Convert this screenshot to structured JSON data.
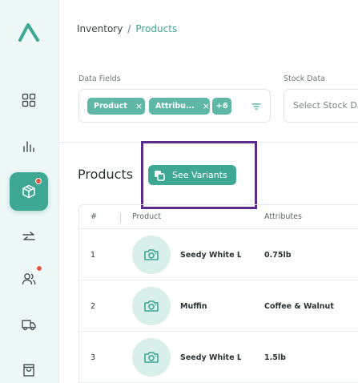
{
  "breadcrumb": {
    "root": "Inventory",
    "separator": "/",
    "current": "Products"
  },
  "filters": {
    "data_fields": {
      "label": "Data Fields",
      "chips": [
        {
          "label": "Product",
          "remove": "×"
        },
        {
          "label": "Attribu...",
          "remove": "×"
        }
      ],
      "more": "+6"
    },
    "stock_data": {
      "label": "Stock Data",
      "placeholder": "Select Stock Da"
    }
  },
  "products": {
    "title": "Products",
    "see_variants": "See Variants"
  },
  "table": {
    "headers": {
      "index": "#",
      "product": "Product",
      "attributes": "Attributes"
    },
    "rows": [
      {
        "index": "1",
        "name": "Seedy White Loa",
        "attributes": "0.75lb"
      },
      {
        "index": "2",
        "name": "Muffin",
        "attributes": "Coffee & Walnut"
      },
      {
        "index": "3",
        "name": "Seedy White Loa",
        "attributes": "1.5lb"
      }
    ]
  },
  "colors": {
    "accent": "#3ea894",
    "chip": "#5fb8a6",
    "sidebar": "#eef8f6",
    "highlight": "#5b2d8a",
    "badge": "#e2553f"
  },
  "icons": {
    "sidebar": [
      "logo-icon",
      "dashboard-icon",
      "analytics-icon",
      "products-box-icon",
      "transfer-icon",
      "users-icon",
      "truck-icon",
      "shopping-bag-icon"
    ],
    "thumb": "camera-icon",
    "filter": "filter-icon",
    "variants": "variants-icon"
  }
}
